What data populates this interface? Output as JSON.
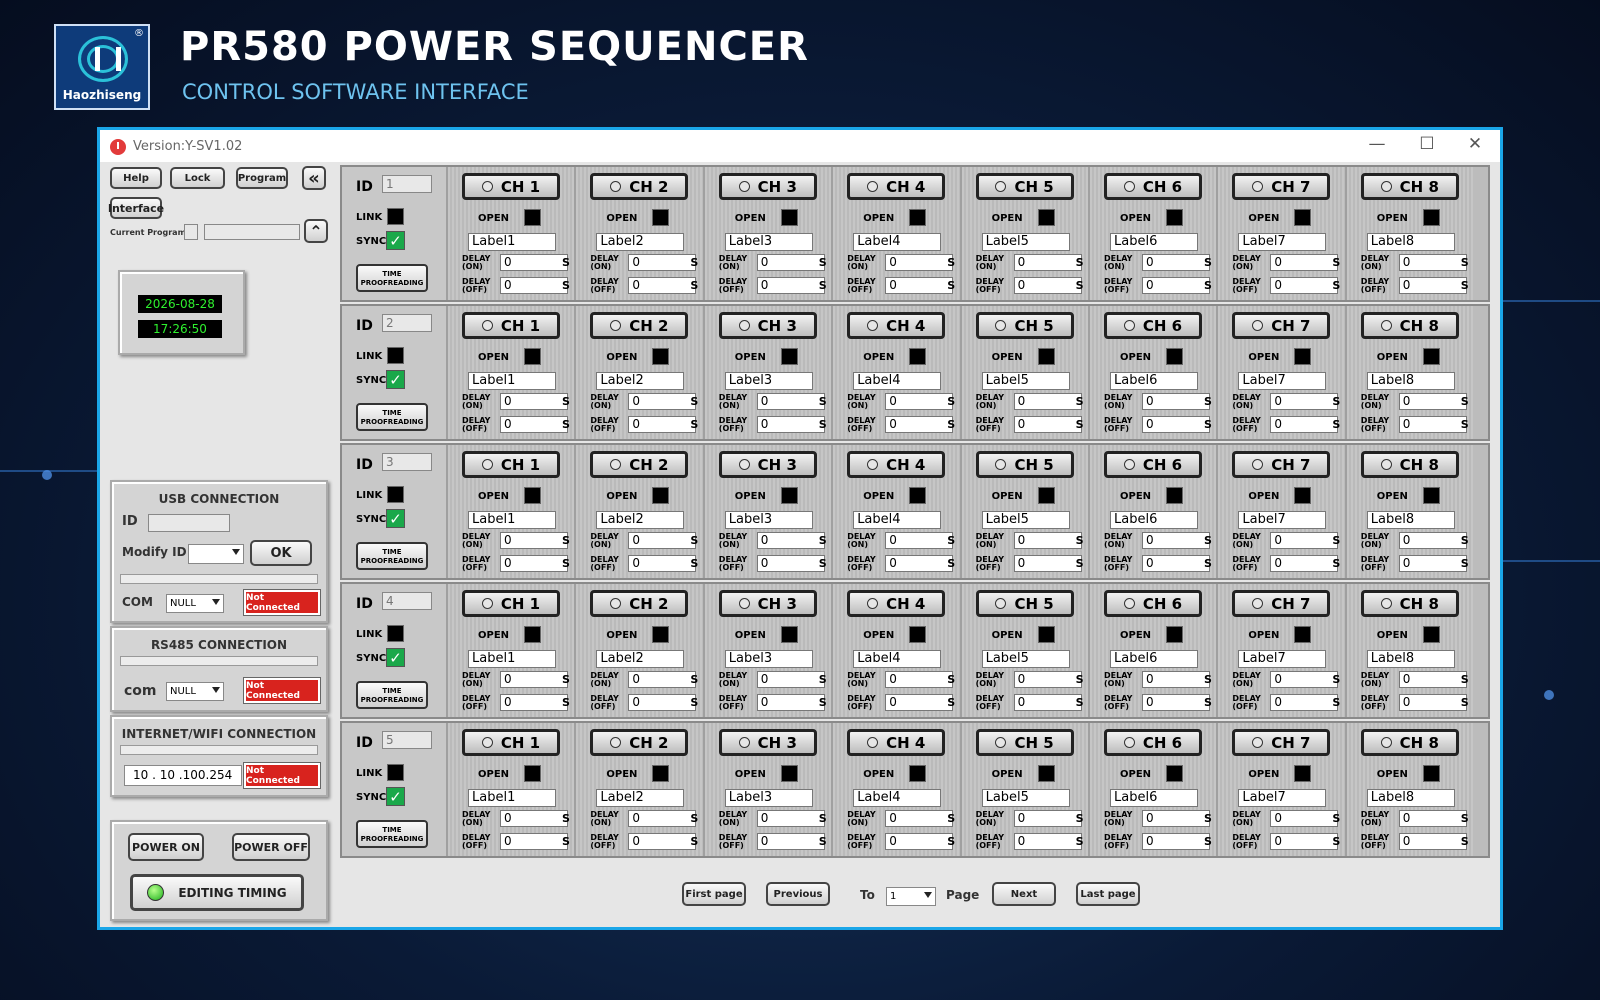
{
  "header": {
    "logo_text": "Haozhiseng",
    "logo_mark": "®",
    "title": "PR580 POWER SEQUENCER",
    "subtitle": "CONTROL SOFTWARE INTERFACE"
  },
  "window": {
    "version": "Version:Y-SV1.02",
    "min": "—",
    "max": "☐",
    "close": "✕"
  },
  "toolbar": {
    "help": "Help",
    "lock": "Lock",
    "program": "Program",
    "interface": "Interface",
    "collapse": "«",
    "current_program_label": "Current Program",
    "up": "⌃"
  },
  "clock": {
    "date": "2026-08-28",
    "time": "17:26:50"
  },
  "usb": {
    "title": "USB CONNECTION",
    "id_label": "ID",
    "modify_label": "Modify ID",
    "ok": "OK",
    "com_label": "COM",
    "com_value": "NULL",
    "status": "Not Connected"
  },
  "rs485": {
    "title": "RS485  CONNECTION",
    "com_label": "com",
    "com_value": "NULL",
    "status": "Not Connected"
  },
  "wifi": {
    "title": "INTERNET/WIFI  CONNECTION",
    "ip": "10 . 10 .100.254",
    "status": "Not Connected"
  },
  "power": {
    "on": "POWER ON",
    "off": "POWER OFF",
    "editing": "EDITING TIMING"
  },
  "labels": {
    "id": "ID",
    "link": "LINK",
    "synch": "SYNCH",
    "time_a": "TIME",
    "time_b": "PROOFREADING",
    "open": "OPEN",
    "delay": "DELAY",
    "on": "(ON)",
    "off": "(OFF)",
    "s": "S"
  },
  "rows": [
    {
      "id": "1",
      "channels": [
        {
          "name": "CH 1",
          "label": "Label1",
          "on": "0",
          "off": "0"
        },
        {
          "name": "CH 2",
          "label": "Label2",
          "on": "0",
          "off": "0"
        },
        {
          "name": "CH 3",
          "label": "Label3",
          "on": "0",
          "off": "0"
        },
        {
          "name": "CH 4",
          "label": "Label4",
          "on": "0",
          "off": "0"
        },
        {
          "name": "CH 5",
          "label": "Label5",
          "on": "0",
          "off": "0"
        },
        {
          "name": "CH 6",
          "label": "Label6",
          "on": "0",
          "off": "0"
        },
        {
          "name": "CH 7",
          "label": "Label7",
          "on": "0",
          "off": "0"
        },
        {
          "name": "CH 8",
          "label": "Label8",
          "on": "0",
          "off": "0"
        }
      ]
    },
    {
      "id": "2",
      "channels": [
        {
          "name": "CH 1",
          "label": "Label1",
          "on": "0",
          "off": "0"
        },
        {
          "name": "CH 2",
          "label": "Label2",
          "on": "0",
          "off": "0"
        },
        {
          "name": "CH 3",
          "label": "Label3",
          "on": "0",
          "off": "0"
        },
        {
          "name": "CH 4",
          "label": "Label4",
          "on": "0",
          "off": "0"
        },
        {
          "name": "CH 5",
          "label": "Label5",
          "on": "0",
          "off": "0"
        },
        {
          "name": "CH 6",
          "label": "Label6",
          "on": "0",
          "off": "0"
        },
        {
          "name": "CH 7",
          "label": "Label7",
          "on": "0",
          "off": "0"
        },
        {
          "name": "CH 8",
          "label": "Label8",
          "on": "0",
          "off": "0"
        }
      ]
    },
    {
      "id": "3",
      "channels": [
        {
          "name": "CH 1",
          "label": "Label1",
          "on": "0",
          "off": "0"
        },
        {
          "name": "CH 2",
          "label": "Label2",
          "on": "0",
          "off": "0"
        },
        {
          "name": "CH 3",
          "label": "Label3",
          "on": "0",
          "off": "0"
        },
        {
          "name": "CH 4",
          "label": "Label4",
          "on": "0",
          "off": "0"
        },
        {
          "name": "CH 5",
          "label": "Label5",
          "on": "0",
          "off": "0"
        },
        {
          "name": "CH 6",
          "label": "Label6",
          "on": "0",
          "off": "0"
        },
        {
          "name": "CH 7",
          "label": "Label7",
          "on": "0",
          "off": "0"
        },
        {
          "name": "CH 8",
          "label": "Label8",
          "on": "0",
          "off": "0"
        }
      ]
    },
    {
      "id": "4",
      "channels": [
        {
          "name": "CH 1",
          "label": "Label1",
          "on": "0",
          "off": "0"
        },
        {
          "name": "CH 2",
          "label": "Label2",
          "on": "0",
          "off": "0"
        },
        {
          "name": "CH 3",
          "label": "Label3",
          "on": "0",
          "off": "0"
        },
        {
          "name": "CH 4",
          "label": "Label4",
          "on": "0",
          "off": "0"
        },
        {
          "name": "CH 5",
          "label": "Label5",
          "on": "0",
          "off": "0"
        },
        {
          "name": "CH 6",
          "label": "Label6",
          "on": "0",
          "off": "0"
        },
        {
          "name": "CH 7",
          "label": "Label7",
          "on": "0",
          "off": "0"
        },
        {
          "name": "CH 8",
          "label": "Label8",
          "on": "0",
          "off": "0"
        }
      ]
    },
    {
      "id": "5",
      "channels": [
        {
          "name": "CH 1",
          "label": "Label1",
          "on": "0",
          "off": "0"
        },
        {
          "name": "CH 2",
          "label": "Label2",
          "on": "0",
          "off": "0"
        },
        {
          "name": "CH 3",
          "label": "Label3",
          "on": "0",
          "off": "0"
        },
        {
          "name": "CH 4",
          "label": "Label4",
          "on": "0",
          "off": "0"
        },
        {
          "name": "CH 5",
          "label": "Label5",
          "on": "0",
          "off": "0"
        },
        {
          "name": "CH 6",
          "label": "Label6",
          "on": "0",
          "off": "0"
        },
        {
          "name": "CH 7",
          "label": "Label7",
          "on": "0",
          "off": "0"
        },
        {
          "name": "CH 8",
          "label": "Label8",
          "on": "0",
          "off": "0"
        }
      ]
    }
  ],
  "pager": {
    "first": "First page",
    "prev": "Previous",
    "to": "To",
    "page_value": "1",
    "page": "Page",
    "next": "Next",
    "last": "Last page"
  },
  "colors": {
    "accent": "#1aa6e8",
    "not_connected": "#d8231e",
    "clock_text": "#2ef02e",
    "check": "#1aa84a"
  }
}
